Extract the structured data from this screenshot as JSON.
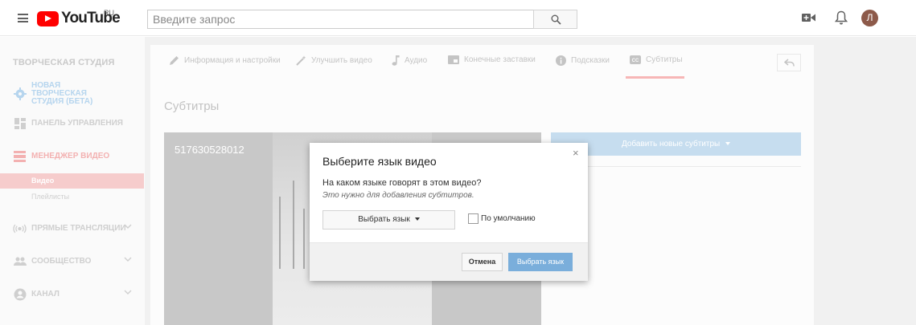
{
  "header": {
    "logo_text": "YouTube",
    "region": "RU",
    "search_placeholder": "Введите запрос",
    "avatar_letter": "Л"
  },
  "sidebar": {
    "title": "ТВОРЧЕСКАЯ СТУДИЯ",
    "items": [
      {
        "label": "НОВАЯ ТВОРЧЕСКАЯ СТУДИЯ (БЕТА)",
        "icon": "gear-icon"
      },
      {
        "label": "ПАНЕЛЬ УПРАВЛЕНИЯ",
        "icon": "dashboard-icon"
      },
      {
        "label": "МЕНЕДЖЕР ВИДЕО",
        "icon": "video-manager-icon"
      },
      {
        "label": "ПРЯМЫЕ ТРАНСЛЯЦИИ",
        "icon": "broadcast-icon"
      },
      {
        "label": "СООБЩЕСТВО",
        "icon": "people-icon"
      },
      {
        "label": "КАНАЛ",
        "icon": "account-icon"
      }
    ],
    "subitems": [
      {
        "label": "Видео",
        "active": true
      },
      {
        "label": "Плейлисты",
        "active": false
      }
    ]
  },
  "tabs": [
    {
      "label": "Информация и настройки",
      "icon": "pencil-icon"
    },
    {
      "label": "Улучшить видео",
      "icon": "magic-wand-icon"
    },
    {
      "label": "Аудио",
      "icon": "music-note-icon"
    },
    {
      "label": "Конечные заставки",
      "icon": "end-screen-icon"
    },
    {
      "label": "Подсказки",
      "icon": "info-icon"
    },
    {
      "label": "Субтитры",
      "icon": "cc-icon",
      "active": true
    }
  ],
  "page": {
    "section_title": "Субтитры",
    "video_id": "517630528012",
    "add_subtitles_label": "Добавить новые субтитры"
  },
  "dialog": {
    "title": "Выберите язык видео",
    "question": "На каком языке говорят в этом видео?",
    "note": "Это нужно для добавления субтитров.",
    "select_label": "Выбрать язык",
    "default_checkbox_label": "По умолчанию",
    "cancel_label": "Отмена",
    "ok_label": "Выбрать язык",
    "close_glyph": "×"
  },
  "colors": {
    "brand_red": "#ff0000",
    "primary_button": "#7aaedb",
    "active_sidebar": "#f6cccc"
  }
}
